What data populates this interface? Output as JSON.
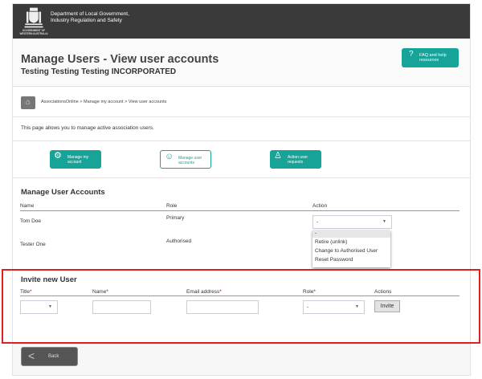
{
  "header": {
    "dept_line1": "Department of Local Government,",
    "dept_line2": "Industry Regulation and Safety",
    "crest_text": "GOVERNMENT OF WESTERN AUSTRALIA"
  },
  "title": {
    "main": "Manage Users - View user accounts",
    "sub": "Testing Testing Testing INCORPORATED",
    "faq_label": "FAQ and help resources",
    "faq_icon": "?"
  },
  "breadcrumb": {
    "text": "AssociationsOnline > Manage my account > View user accounts"
  },
  "description": "This page allows you to manage active association users.",
  "nav": [
    {
      "label": "Manage my account",
      "icon": "gear-icon"
    },
    {
      "label": "Manage user accounts",
      "icon": "users-icon"
    },
    {
      "label": "Action user requests",
      "icon": "user-add-icon"
    }
  ],
  "manage": {
    "heading": "Manage User Accounts",
    "columns": [
      "Name",
      "Role",
      "Action"
    ],
    "rows": [
      {
        "name": "Tom Doe",
        "role": "Primary",
        "action": "-"
      },
      {
        "name": "Tester One",
        "role": "Authorised"
      }
    ],
    "dropdown_options": [
      "-",
      "Retire (unlink)",
      "Change to Authorised User",
      "Reset Password"
    ]
  },
  "invite": {
    "heading": "Invite new User",
    "columns": [
      "Title",
      "Name",
      "Email address",
      "Role",
      "Actions"
    ],
    "required_mark": "*",
    "title_value": "",
    "name_value": "",
    "email_value": "",
    "role_value": "-",
    "invite_label": "Invite"
  },
  "back_label": "Back",
  "colors": {
    "accent": "#17a398",
    "header": "#3a3a3a",
    "highlight": "#e02020"
  }
}
